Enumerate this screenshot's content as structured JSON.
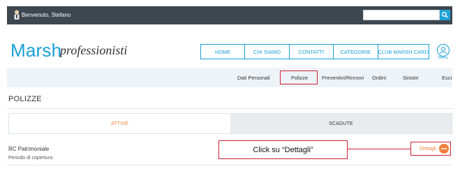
{
  "header": {
    "welcome_text": "Benvenuto, Stefano",
    "search_placeholder": "",
    "search_icon": "search-icon"
  },
  "logo": {
    "main": "Marsh",
    "sub": "professionisti"
  },
  "nav": {
    "items": [
      "HOME",
      "CHI SIAMO",
      "CONTATTI",
      "CATEGORIE",
      "CLUB MARSH CARD"
    ],
    "menu_label": "Menu"
  },
  "subnav": {
    "items": [
      "Dati Personali",
      "Polizze",
      "Preventivi/Rinnovi",
      "Ordini",
      "Sinistri",
      "Esci"
    ]
  },
  "page": {
    "title": "POLIZZE"
  },
  "tabs": [
    "ATTIVE",
    "SCADUTE"
  ],
  "policy": {
    "name": "RC Patrimoniale",
    "period_label": "Periodo di copertura:",
    "detail_label": "Dettagli"
  },
  "callout": {
    "text": "Click su “Dettagli”"
  },
  "colors": {
    "accent": "#1a9fd8",
    "orange": "#f07f3c",
    "annotation": "#cc2233",
    "topbar": "#3d4750"
  }
}
